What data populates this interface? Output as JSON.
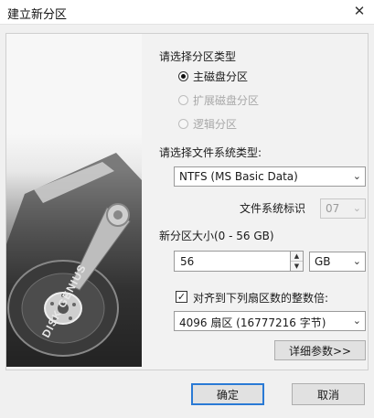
{
  "window": {
    "title": "建立新分区",
    "close_icon": "close-icon"
  },
  "partition_type": {
    "heading": "请选择分区类型",
    "options": [
      {
        "label": "主磁盘分区",
        "selected": true,
        "enabled": true
      },
      {
        "label": "扩展磁盘分区",
        "selected": false,
        "enabled": false
      },
      {
        "label": "逻辑分区",
        "selected": false,
        "enabled": false
      }
    ]
  },
  "filesystem": {
    "heading": "请选择文件系统类型:",
    "selected": "NTFS (MS Basic Data)",
    "id_label": "文件系统标识",
    "id_value": "07"
  },
  "size": {
    "label": "新分区大小(0 - 56 GB)",
    "value": "56",
    "unit": "GB"
  },
  "alignment": {
    "checkbox_label": "对齐到下列扇区数的整数倍:",
    "checked": true,
    "selected": "4096 扇区 (16777216 字节)"
  },
  "buttons": {
    "details": "详细参数>>",
    "ok": "确定",
    "cancel": "取消"
  },
  "banner": {
    "brand_text": "DISK GENIUS"
  }
}
